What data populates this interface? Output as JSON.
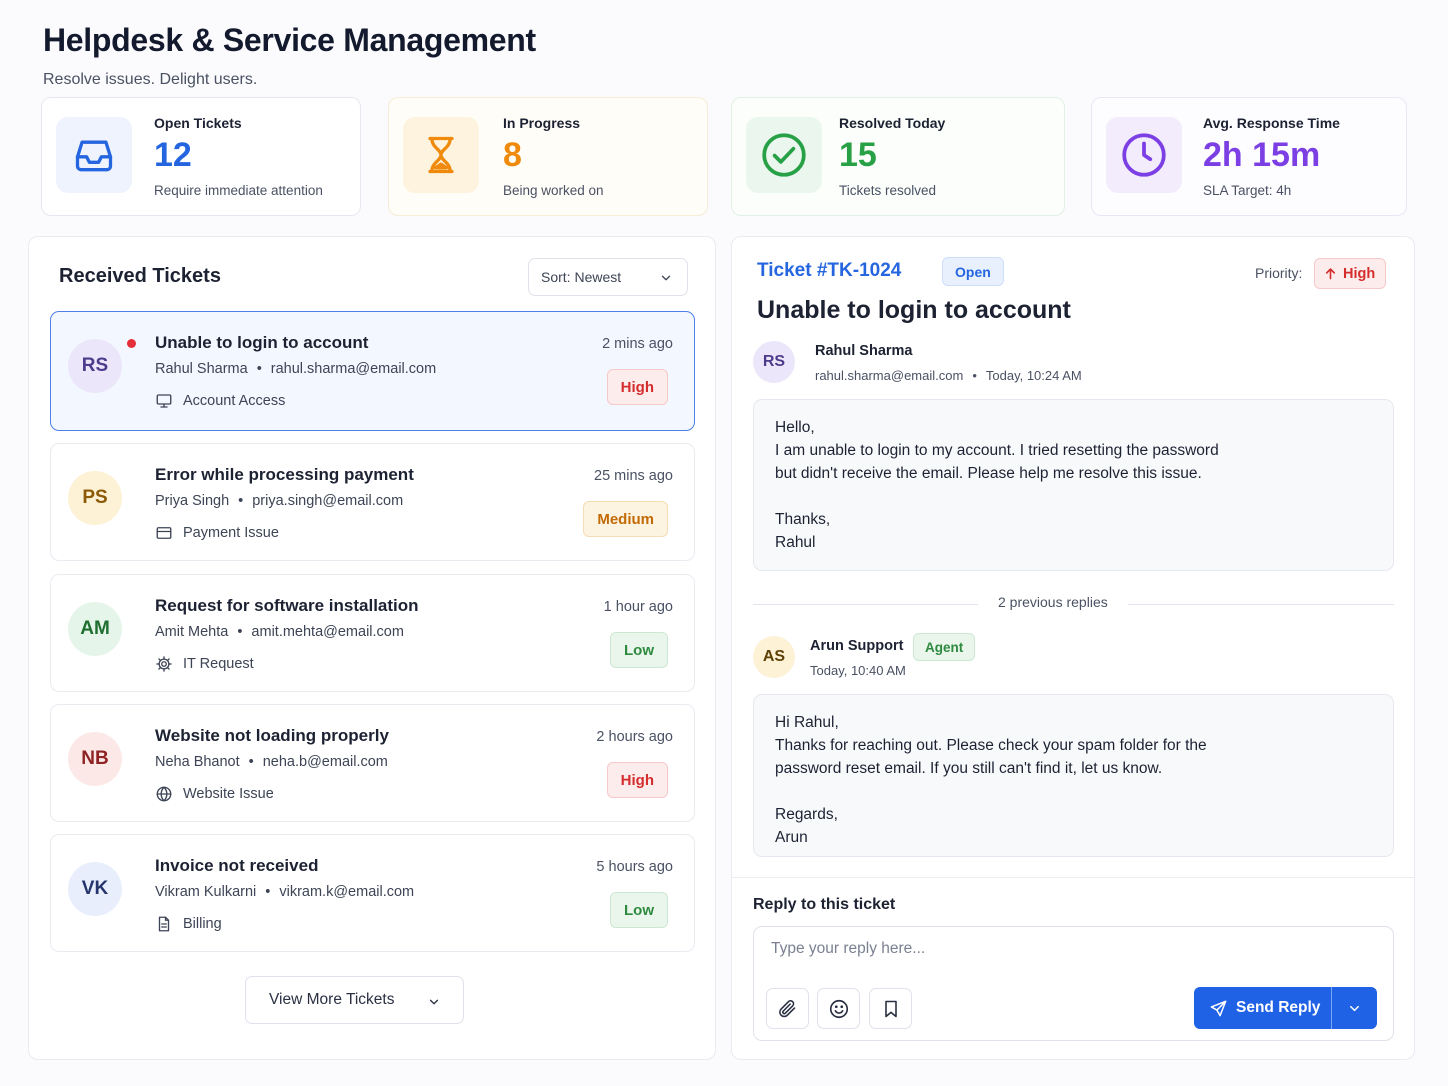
{
  "header": {
    "title": "Helpdesk & Service Management",
    "subtitle": "Resolve issues. Delight users."
  },
  "stats": [
    {
      "label": "Open Tickets",
      "value": "12",
      "sub": "Require immediate attention",
      "icon": "inbox-icon",
      "color": "#2566e0"
    },
    {
      "label": "In Progress",
      "value": "8",
      "sub": "Being worked on",
      "icon": "hourglass-icon",
      "color": "#f08a0c"
    },
    {
      "label": "Resolved Today",
      "value": "15",
      "sub": "Tickets resolved",
      "icon": "check-circle-icon",
      "color": "#27a046"
    },
    {
      "label": "Avg. Response Time",
      "value": "2h 15m",
      "sub": "SLA Target: 4h",
      "icon": "clock-icon",
      "color": "#7b3fe4"
    }
  ],
  "list": {
    "title": "Received Tickets",
    "sort_label": "Sort: Newest",
    "more_label": "View More Tickets",
    "tickets": [
      {
        "initials": "RS",
        "title": "Unable to login to account",
        "name": "Rahul Sharma",
        "email": "rahul.sharma@email.com",
        "category": "Account Access",
        "category_icon": "monitor-icon",
        "time": "2 mins ago",
        "priority": "High",
        "unread": true
      },
      {
        "initials": "PS",
        "title": "Error while processing payment",
        "name": "Priya Singh",
        "email": "priya.singh@email.com",
        "category": "Payment Issue",
        "category_icon": "credit-card-icon",
        "time": "25 mins ago",
        "priority": "Medium"
      },
      {
        "initials": "AM",
        "title": "Request for software installation",
        "name": "Amit Mehta",
        "email": "amit.mehta@email.com",
        "category": "IT Request",
        "category_icon": "gear-icon",
        "time": "1 hour ago",
        "priority": "Low"
      },
      {
        "initials": "NB",
        "title": "Website not loading properly",
        "name": "Neha Bhanot",
        "email": "neha.b@email.com",
        "category": "Website Issue",
        "category_icon": "globe-icon",
        "time": "2 hours ago",
        "priority": "High"
      },
      {
        "initials": "VK",
        "title": "Invoice not received",
        "name": "Vikram Kulkarni",
        "email": "vikram.k@email.com",
        "category": "Billing",
        "category_icon": "document-icon",
        "time": "5 hours ago",
        "priority": "Low"
      }
    ]
  },
  "detail": {
    "ticket_id": "Ticket #TK-1024",
    "status": "Open",
    "priority_label": "Priority:",
    "priority": "High",
    "subject": "Unable to login to account",
    "requester": {
      "initials": "RS",
      "name": "Rahul Sharma",
      "email": "rahul.sharma@email.com",
      "time": "Today, 10:24 AM",
      "lines": [
        "Hello,",
        "I am unable to login to my account. I tried resetting the password",
        "but didn't receive the email. Please help me resolve this issue.",
        "",
        "Thanks,",
        "Rahul"
      ]
    },
    "previous_replies": "2 previous replies",
    "agent": {
      "initials": "AS",
      "name": "Arun Support",
      "role": "Agent",
      "time": "Today, 10:40 AM",
      "lines": [
        "Hi Rahul,",
        "Thanks for reaching out. Please check your spam folder for the",
        "password reset email. If you still can't find it, let us know.",
        "",
        "Regards,",
        "Arun"
      ]
    },
    "reply": {
      "title": "Reply to this ticket",
      "placeholder": "Type your reply here...",
      "send_label": "Send Reply"
    }
  },
  "colors": {
    "accent": "#1f62e6",
    "high": "#d42d2d",
    "medium": "#c26b06",
    "low": "#2e8a3f"
  }
}
